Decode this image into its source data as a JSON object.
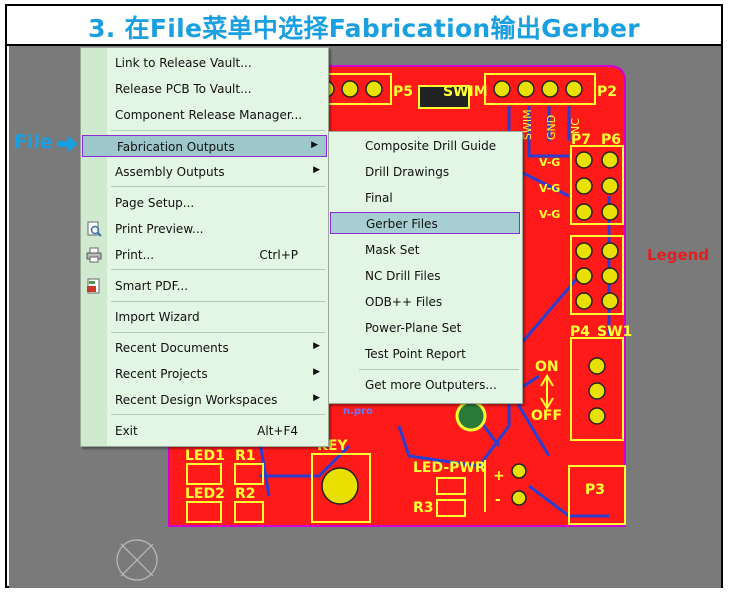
{
  "title": "3. 在File菜单中选择Fabrication输出Gerber",
  "annotations": {
    "file_label": "File",
    "legend_label": "Legend"
  },
  "main_menu": {
    "items": [
      {
        "label": "Link to Release Vault...",
        "shortcut": "",
        "submenu": false
      },
      {
        "label": "Release PCB To Vault...",
        "shortcut": "",
        "submenu": false
      },
      {
        "label": "Component Release Manager...",
        "shortcut": "",
        "submenu": false
      },
      {
        "label": "Fabrication Outputs",
        "shortcut": "",
        "submenu": true
      },
      {
        "label": "Assembly Outputs",
        "shortcut": "",
        "submenu": true
      },
      {
        "label": "Page Setup...",
        "shortcut": "",
        "submenu": false
      },
      {
        "label": "Print Preview...",
        "shortcut": "",
        "submenu": false
      },
      {
        "label": "Print...",
        "shortcut": "Ctrl+P",
        "submenu": false
      },
      {
        "label": "Smart PDF...",
        "shortcut": "",
        "submenu": false
      },
      {
        "label": "Import Wizard",
        "shortcut": "",
        "submenu": false
      },
      {
        "label": "Recent Documents",
        "shortcut": "",
        "submenu": true
      },
      {
        "label": "Recent Projects",
        "shortcut": "",
        "submenu": true
      },
      {
        "label": "Recent Design Workspaces",
        "shortcut": "",
        "submenu": true
      },
      {
        "label": "Exit",
        "shortcut": "Alt+F4",
        "submenu": false
      }
    ]
  },
  "sub_menu": {
    "items": [
      {
        "label": "Composite Drill Guide"
      },
      {
        "label": "Drill Drawings"
      },
      {
        "label": "Final"
      },
      {
        "label": "Gerber Files"
      },
      {
        "label": "Mask Set"
      },
      {
        "label": "NC Drill Files"
      },
      {
        "label": "ODB++ Files"
      },
      {
        "label": "Power-Plane Set"
      },
      {
        "label": "Test Point Report"
      },
      {
        "label": "Get more Outputers..."
      }
    ]
  },
  "pcb": {
    "labels": {
      "p5": "P5",
      "swim": "SWIM",
      "p2": "P2",
      "p7": "P7",
      "p6": "P6",
      "p4": "P4",
      "sw1": "SW1",
      "on": "ON",
      "off": "OFF",
      "p3": "P3",
      "key": "KEY",
      "led_pwr": "LED-PWR",
      "r3": "R3",
      "led1": "LED1",
      "r1": "R1",
      "led2": "LED2",
      "r2": "R2",
      "plus": "+",
      "minus": "-",
      "v_label": "V-G",
      "gnd": "GND",
      "nc": "NC",
      "pro": "n.pro",
      "swim_v": "SWIM"
    }
  },
  "colors": {
    "title": "#1aa0e0",
    "board": "#ff1a1a",
    "silk": "#ffff00",
    "menu_bg": "#e3f5e3",
    "highlight_border": "#8a2bd9",
    "legend": "#e02020"
  }
}
